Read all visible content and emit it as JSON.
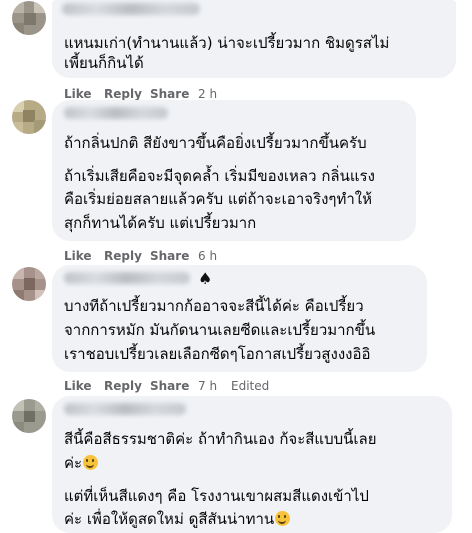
{
  "actions": {
    "like": "Like",
    "reply": "Reply",
    "share": "Share",
    "edited": "Edited"
  },
  "comments": [
    {
      "lines": [
        "แหนมเก่า(ทำนานแล้ว) น่าจะเปรี้ยวมาก ชิมดูรสไม่",
        "เพี้ยนก็กินได้"
      ],
      "time": "2 h"
    },
    {
      "lines": [
        "ถ้ากลิ่นปกติ สียังขาวขึ้นคือยิ่งเปรี้ยวมากขึ้นครับ",
        "ถ้าเริ่มเสียคือจะมีจุดคล้ำ เริ่มมีของเหลว กลิ่นแรง",
        "คือเริ่มย่อยสลายแล้วครับ แต่ถ้าจะเอาจริงๆทำให้",
        "สุกก็ทานได้ครับ แต่เปรี้ยวมาก"
      ],
      "time": "6 h"
    },
    {
      "badge": "spade-icon",
      "lines": [
        "บางทีถ้าเปรี้ยวมากก้ออาจจะสีนี้ได้ค่ะ คือเปรี้ยว",
        "จากการหมัก มันกัดนานเลยซีดและเปรี้ยวมากขึ้น",
        "เราชอบเปรี้ยวเลยเลือกซีดๆโอกาสเปรี้ยวสูงงงอิอิ"
      ],
      "time": "7 h",
      "edited": true
    },
    {
      "lines": [
        "สีนี้คือสีธรรมชาติค่ะ ถ้าทำกินเอง ก้จะสีแบบนี้เลย",
        "ค่ะ",
        "แต่ที่เห็นสีแดงๆ คือ โรงงานเขาผสมสีแดงเข้าไป",
        "ค่ะ เพื่อให้ดูสดใหม่ ดูสีสันน่าทาน"
      ],
      "emoji_after_lines": [
        1,
        3
      ],
      "emoji": "smiling-face-emoji"
    }
  ]
}
